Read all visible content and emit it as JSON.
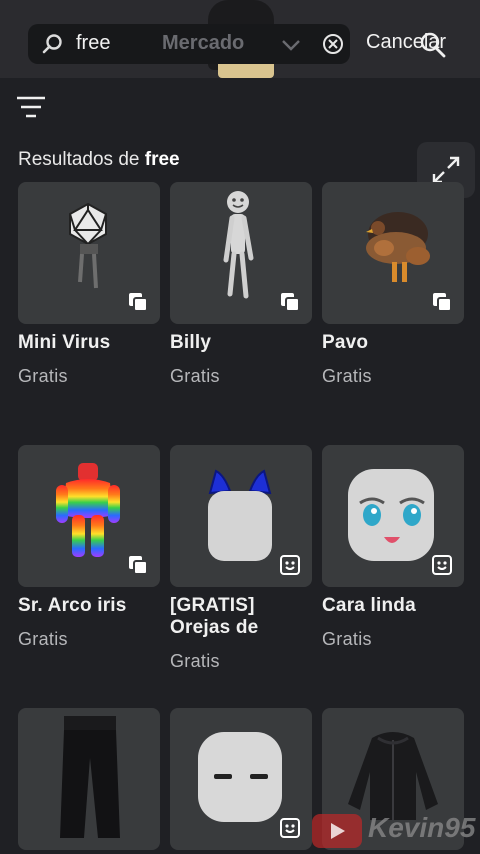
{
  "search": {
    "query": "free",
    "scope": "Mercado",
    "cancel_label": "Cancelar"
  },
  "results": {
    "prefix": "Resultados de",
    "query": "free"
  },
  "items": [
    {
      "name": "Mini Virus",
      "price": "Gratis",
      "badge": "layers-icon",
      "art": "icosahedron"
    },
    {
      "name": "Billy",
      "price": "Gratis",
      "badge": "layers-icon",
      "art": "stick-figure"
    },
    {
      "name": "Pavo",
      "price": "Gratis",
      "badge": "layers-icon",
      "art": "turkey"
    },
    {
      "name": "Sr. Arco iris",
      "price": "Gratis",
      "badge": "layers-icon",
      "art": "rainbow-man"
    },
    {
      "name": "[GRATIS] Orejas de",
      "price": "Gratis",
      "badge": "face-icon",
      "art": "cat-ears-head"
    },
    {
      "name": "Cara linda",
      "price": "Gratis",
      "badge": "face-icon",
      "art": "anime-face"
    },
    {
      "name": "",
      "price": "",
      "badge": "",
      "art": "black-pants"
    },
    {
      "name": "",
      "price": "",
      "badge": "face-icon",
      "art": "simple-face"
    },
    {
      "name": "",
      "price": "",
      "badge": "",
      "art": "black-jacket"
    }
  ],
  "watermark": {
    "text": "Kevin95"
  },
  "colors": {
    "background": "#1f2024",
    "card": "#393b3d",
    "topbar": "#2b2b2f",
    "price": "#b6b7ba"
  }
}
